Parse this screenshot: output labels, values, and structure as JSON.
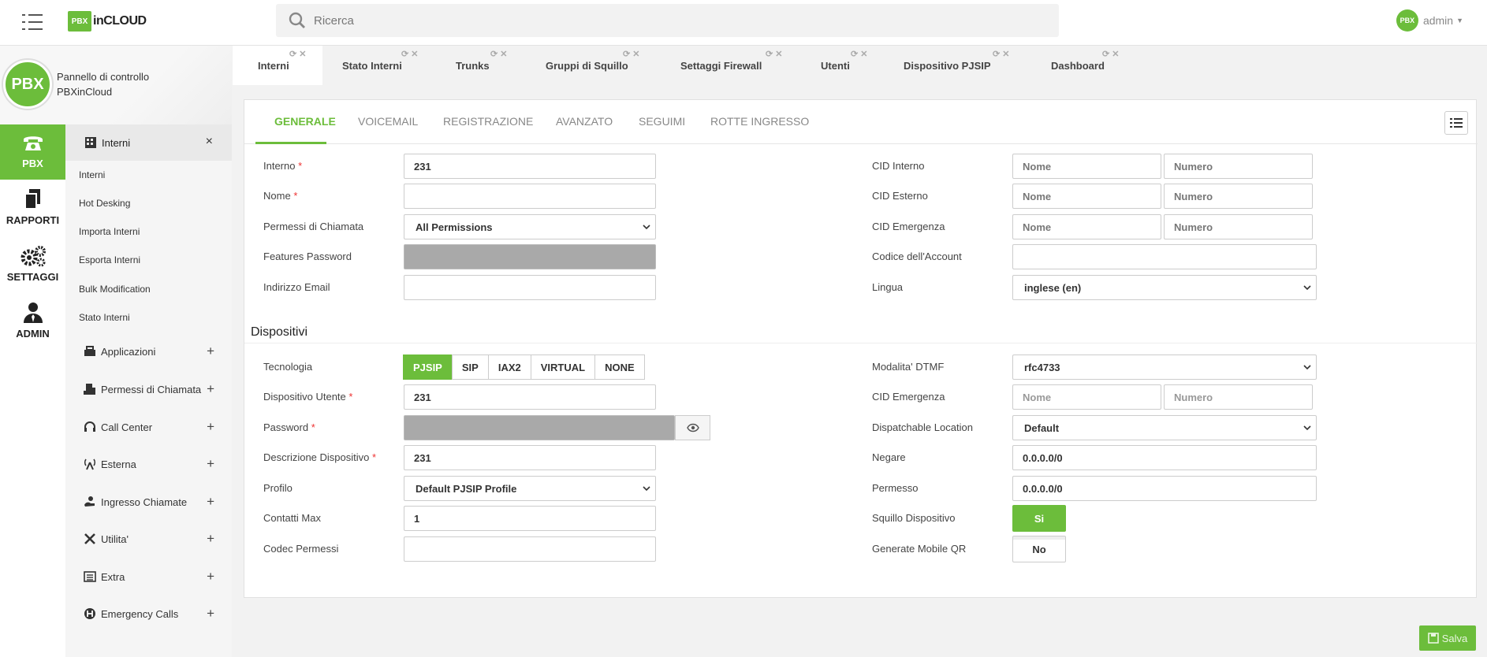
{
  "header": {
    "logo_box": "PBX",
    "logo_text": "inCLOUD",
    "search_placeholder": "Ricerca",
    "user_avatar": "PBX",
    "user_name": "admin"
  },
  "brand": {
    "circle": "PBX",
    "line1": "Pannello di controllo",
    "line2": "PBXinCloud"
  },
  "rail": [
    {
      "label": "PBX",
      "icon": "phone-icon"
    },
    {
      "label": "RAPPORTI",
      "icon": "documents-icon"
    },
    {
      "label": "SETTAGGI",
      "icon": "gears-icon"
    },
    {
      "label": "ADMIN",
      "icon": "admin-user-icon"
    }
  ],
  "menu": {
    "open_group": "Interni",
    "open_group_close": "×",
    "sub_items": [
      "Interni",
      "Hot Desking",
      "Importa Interni",
      "Esporta Interni",
      "Bulk Modification",
      "Stato Interni"
    ],
    "groups": [
      {
        "label": "Applicazioni",
        "icon": "applications-icon"
      },
      {
        "label": "Permessi di Chiamata",
        "icon": "permissions-icon"
      },
      {
        "label": "Call Center",
        "icon": "headset-icon"
      },
      {
        "label": "Esterna",
        "icon": "antenna-icon"
      },
      {
        "label": "Ingresso Chiamate",
        "icon": "incoming-call-icon"
      },
      {
        "label": "Utilita'",
        "icon": "tools-icon"
      },
      {
        "label": "Extra",
        "icon": "extra-list-icon"
      },
      {
        "label": "Emergency Calls",
        "icon": "emergency-icon"
      }
    ],
    "plus": "+"
  },
  "tabs": [
    "Interni",
    "Stato Interni",
    "Trunks",
    "Gruppi di Squillo",
    "Settaggi Firewall",
    "Utenti",
    "Dispositivo PJSIP",
    "Dashboard"
  ],
  "subtabs": [
    "GENERALE",
    "VOICEMAIL",
    "REGISTRAZIONE",
    "AVANZATO",
    "SEGUIMI",
    "ROTTE INGRESSO"
  ],
  "form": {
    "interno_label": "Interno",
    "interno_value": "231",
    "nome_label": "Nome",
    "nome_value": "",
    "permessi_label": "Permessi di Chiamata",
    "permessi_value": "All Permissions",
    "features_pwd_label": "Features Password",
    "email_label": "Indirizzo Email",
    "email_value": "",
    "cid_interno_label": "CID Interno",
    "cid_esterno_label": "CID Esterno",
    "cid_emergenza_label": "CID Emergenza",
    "codice_label": "Codice dell'Account",
    "codice_value": "",
    "lingua_label": "Lingua",
    "lingua_value": "inglese (en)",
    "cid_nome_ph": "Nome",
    "cid_numero_ph": "Numero",
    "required_mark": "*"
  },
  "dispositivi": {
    "title": "Dispositivi",
    "tecnologia_label": "Tecnologia",
    "tecnologia_options": [
      "PJSIP",
      "SIP",
      "IAX2",
      "VIRTUAL",
      "NONE"
    ],
    "tecnologia_selected": "PJSIP",
    "disp_utente_label": "Dispositivo Utente",
    "disp_utente_value": "231",
    "password_label": "Password",
    "descrizione_label": "Descrizione Dispositivo",
    "descrizione_value": "231",
    "profilo_label": "Profilo",
    "profilo_value": "Default PJSIP Profile",
    "contatti_label": "Contatti Max",
    "contatti_value": "1",
    "codec_label": "Codec Permessi",
    "codec_value": "",
    "dtmf_label": "Modalita' DTMF",
    "dtmf_value": "rfc4733",
    "cid_emergenza_label": "CID Emergenza",
    "dispatch_label": "Dispatchable Location",
    "dispatch_value": "Default",
    "negare_label": "Negare",
    "negare_value": "0.0.0.0/0",
    "permesso_label": "Permesso",
    "permesso_value": "0.0.0.0/0",
    "squillo_label": "Squillo Dispositivo",
    "squillo_value": "Si",
    "mobile_qr_label": "Generate Mobile QR",
    "mobile_qr_value": "No"
  },
  "footer": {
    "save_label": "Salva"
  },
  "colors": {
    "accent": "#6cbd3b"
  }
}
